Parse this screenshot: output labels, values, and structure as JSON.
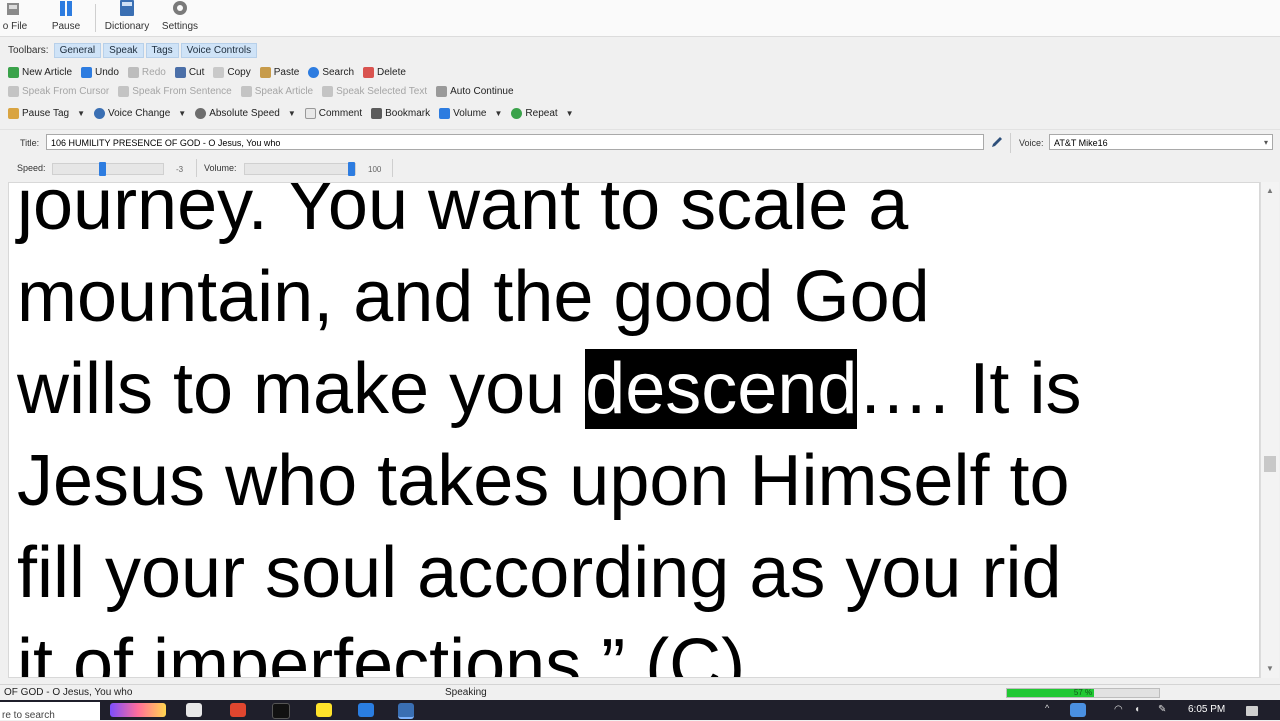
{
  "ribbon": {
    "file_label": "o File",
    "pause_label": "Pause",
    "dictionary_label": "Dictionary",
    "settings_label": "Settings"
  },
  "toolbars": {
    "label": "Toolbars:",
    "tabs": [
      "General",
      "Speak",
      "Tags",
      "Voice Controls"
    ],
    "row1": [
      "New Article",
      "Undo",
      "Redo",
      "Cut",
      "Copy",
      "Paste",
      "Search",
      "Delete"
    ],
    "row2": [
      "Speak From Cursor",
      "Speak From Sentence",
      "Speak Article",
      "Speak Selected Text",
      "Auto Continue"
    ],
    "row3": [
      "Pause Tag",
      "Voice Change",
      "Absolute Speed",
      "Comment",
      "Bookmark",
      "Volume",
      "Repeat"
    ]
  },
  "title_row": {
    "title_label": "Title:",
    "title_value": "106 HUMILITY PRESENCE OF GOD - O Jesus, You who",
    "voice_label": "Voice:",
    "voice_value": "AT&T Mike16"
  },
  "sliders": {
    "speed_label": "Speed:",
    "speed_value": "-3",
    "speed_fraction": 0.45,
    "volume_label": "Volume:",
    "volume_value": "100",
    "volume_fraction": 1.0
  },
  "reader": {
    "line1": "journey.  You want to scale a",
    "line2": "mountain, and the good God",
    "line3_before": "wills to make you ",
    "line3_highlight": "descend",
    "line3_after": "…. It is",
    "line4": "Jesus who takes upon Himself to",
    "line5": "fill your soul according as you rid",
    "line6": "it of imperfections.” (C)"
  },
  "statusbar": {
    "left_text": "OF GOD - O Jesus, You who",
    "state_text": "Speaking",
    "progress_text": "57 %",
    "progress_fraction": 0.57
  },
  "taskbar": {
    "search_text": "re to search",
    "time": "6:05 PM"
  },
  "colors": {
    "accent": "#2d7ce0",
    "progress": "#21c834",
    "highlight_bg": "#000000",
    "highlight_fg": "#ffffff"
  }
}
